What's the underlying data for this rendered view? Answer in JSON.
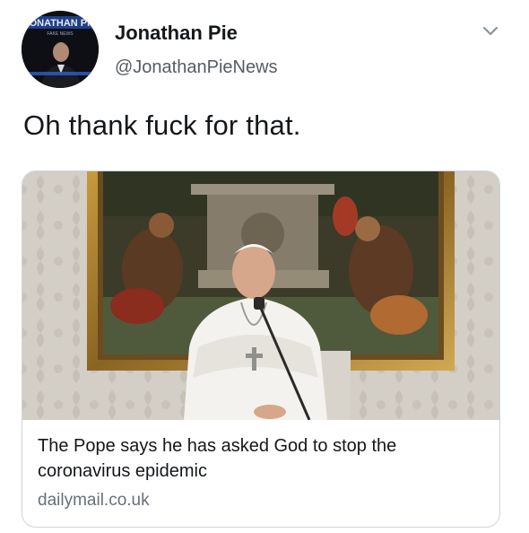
{
  "author": {
    "name": "Jonathan Pie",
    "handle": "@JonathanPieNews",
    "avatar_banner_text": "JONATHAN PIE",
    "avatar_sub_text": "FAKE NEWS"
  },
  "tweet": {
    "text": "Oh thank fuck for that."
  },
  "link_card": {
    "title": "The Pope says he has asked God to stop the coronavirus epidemic",
    "domain": "dailymail.co.uk"
  },
  "icons": {
    "menu": "chevron-down-icon"
  }
}
